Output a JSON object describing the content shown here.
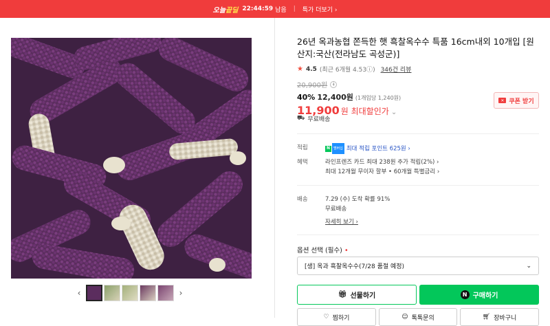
{
  "topbar": {
    "brand_prefix": "오늘",
    "brand_highlight": "끝딜",
    "timer": "22:44:59",
    "timer_suffix": "남음",
    "more": "특가 더보기"
  },
  "product": {
    "title": "26년 옥과농협 쫀득한 햇 흑찰옥수수 특품 16cm내외 10개입 [원산지:국산(전라남도 곡성군)]",
    "rating": "4.5",
    "rating_meta": "(최근 6개월 4.53",
    "rating_meta_end": ")",
    "reviews": "346건 리뷰",
    "original_price": "20,900원",
    "discount": "40%",
    "sale_price": "12,400원",
    "unit_price": "(1개입당 1,240원)",
    "best_price": "11,900",
    "best_price_label": "원 최대할인가",
    "coupon_button": "쿠폰 받기",
    "free_shipping": "무료배송"
  },
  "benefits": {
    "point_key": "적립",
    "point_badge": "멤버십",
    "point_text": "최대 적립 포인트 625원",
    "benefit_key": "혜택",
    "benefit_line1": "라인프렌즈 카드 최대 238원 추가 적립(2%)",
    "benefit_line2": "최대 12개월 무이자 할부 • 60개월 특별금리"
  },
  "delivery": {
    "key": "배송",
    "arrival": "7.29 (수) 도착 확률 91%",
    "fee": "무료배송",
    "details_link": "자세히 보기"
  },
  "option": {
    "label": "옵션 선택 (필수)",
    "required_mark": "•",
    "selected": "[생] 옥과 흑찰옥수수(7/28 품절 예정)"
  },
  "buttons": {
    "gift": "선물하기",
    "buy": "구매하기",
    "wish": "찜하기",
    "talk": "톡톡문의",
    "cart": "장바구니"
  },
  "colors": {
    "accent_red": "#f03c3c",
    "naver_green": "#03c75a"
  }
}
